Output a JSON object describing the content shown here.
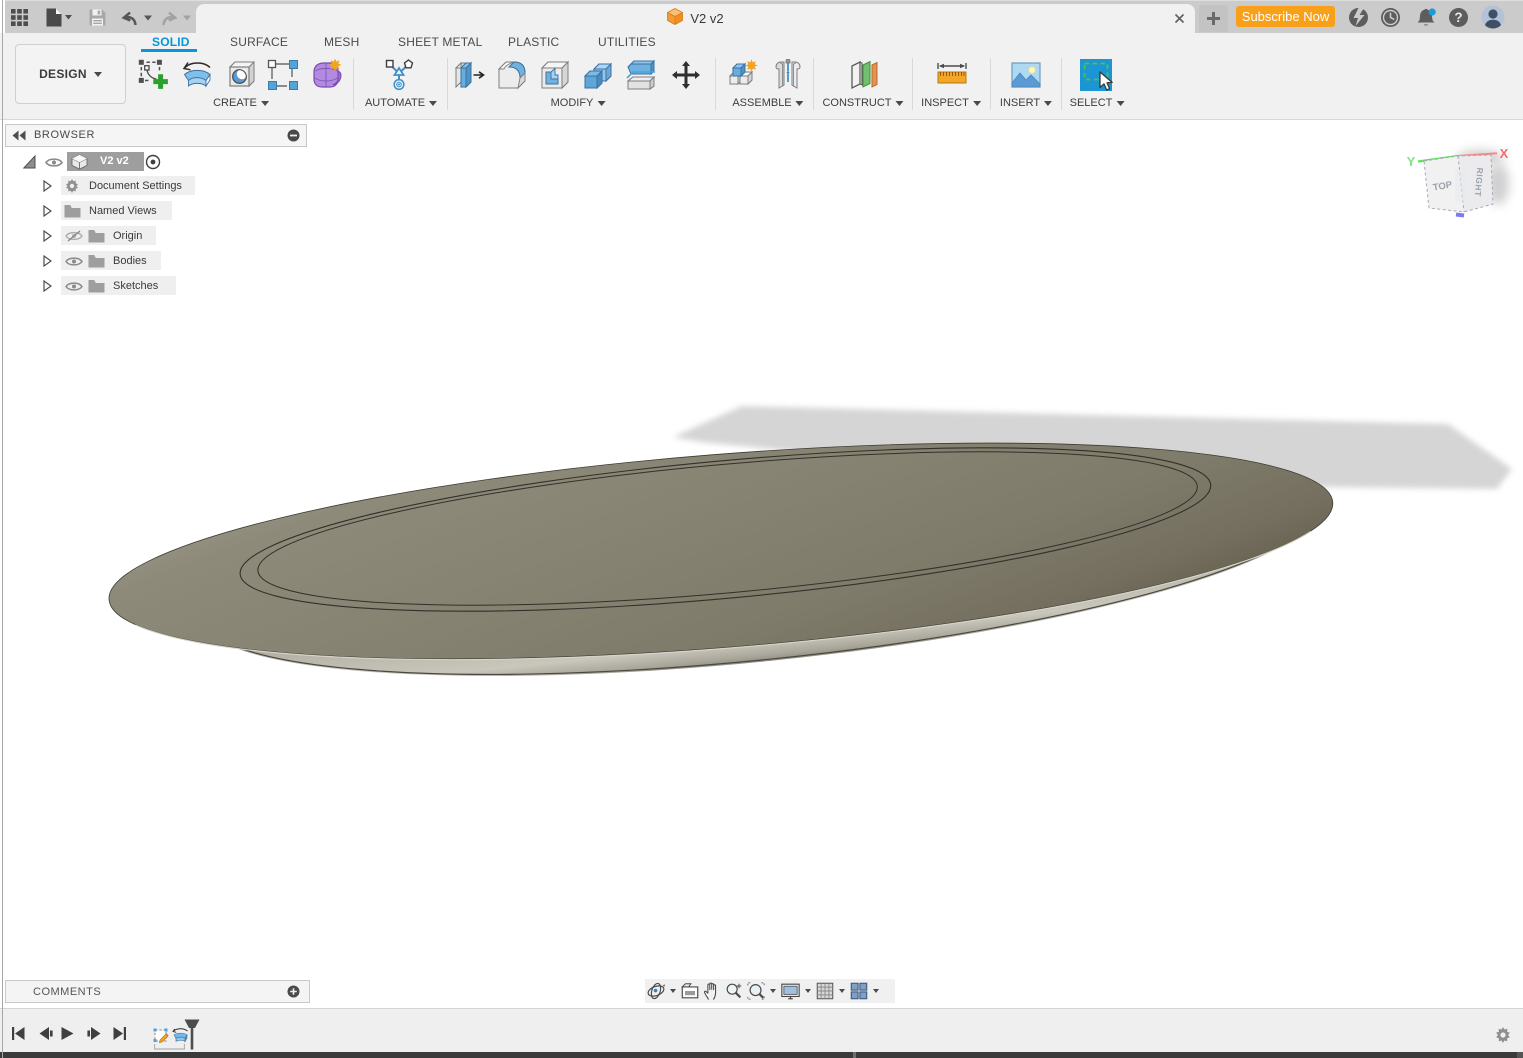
{
  "colors": {
    "accent_blue": "#0696d7",
    "subscribe_orange": "#f9a01b",
    "notification_blue": "#1b9bd7",
    "select_blue": "#1b95d4",
    "topbar_gray": "#cbcbcb",
    "ribbon_bg": "#f1f1f1",
    "canvas_bg": "#ffffff",
    "model_gray": "#868372"
  },
  "topbar": {
    "tab": {
      "title": "V2 v2"
    },
    "subscribe_label": "Subscribe Now",
    "help_glyph": "?"
  },
  "ribbon": {
    "design_label": "DESIGN",
    "tabs": [
      {
        "label": "SOLID",
        "active": true
      },
      {
        "label": "SURFACE"
      },
      {
        "label": "MESH"
      },
      {
        "label": "SHEET METAL"
      },
      {
        "label": "PLASTIC"
      },
      {
        "label": "UTILITIES"
      }
    ],
    "groups": [
      {
        "label": "CREATE"
      },
      {
        "label": "AUTOMATE"
      },
      {
        "label": "MODIFY"
      },
      {
        "label": "ASSEMBLE"
      },
      {
        "label": "CONSTRUCT"
      },
      {
        "label": "INSPECT"
      },
      {
        "label": "INSERT"
      },
      {
        "label": "SELECT"
      }
    ]
  },
  "browser": {
    "header": "BROWSER",
    "root": {
      "label": "V2 v2"
    },
    "items": [
      {
        "label": "Document Settings",
        "icon": "gear-icon",
        "eye": "none"
      },
      {
        "label": "Named Views",
        "icon": "folder-icon",
        "eye": "none"
      },
      {
        "label": "Origin",
        "icon": "folder-icon",
        "eye": "hidden"
      },
      {
        "label": "Bodies",
        "icon": "folder-icon",
        "eye": "visible"
      },
      {
        "label": "Sketches",
        "icon": "folder-icon",
        "eye": "visible"
      }
    ]
  },
  "viewcube": {
    "top_label": "TOP",
    "right_label": "RIGHT",
    "axis_x": "X",
    "axis_y": "Y"
  },
  "comments": {
    "label": "COMMENTS"
  },
  "navbar": {
    "icons": [
      "orbit",
      "look-at",
      "pan",
      "zoom",
      "fit",
      "display-settings",
      "grid",
      "viewports"
    ]
  },
  "timeline": {
    "controls": [
      "go-to-start",
      "step-back",
      "play",
      "step-forward",
      "go-to-end"
    ],
    "features": [
      "sketch",
      "revolve"
    ]
  }
}
